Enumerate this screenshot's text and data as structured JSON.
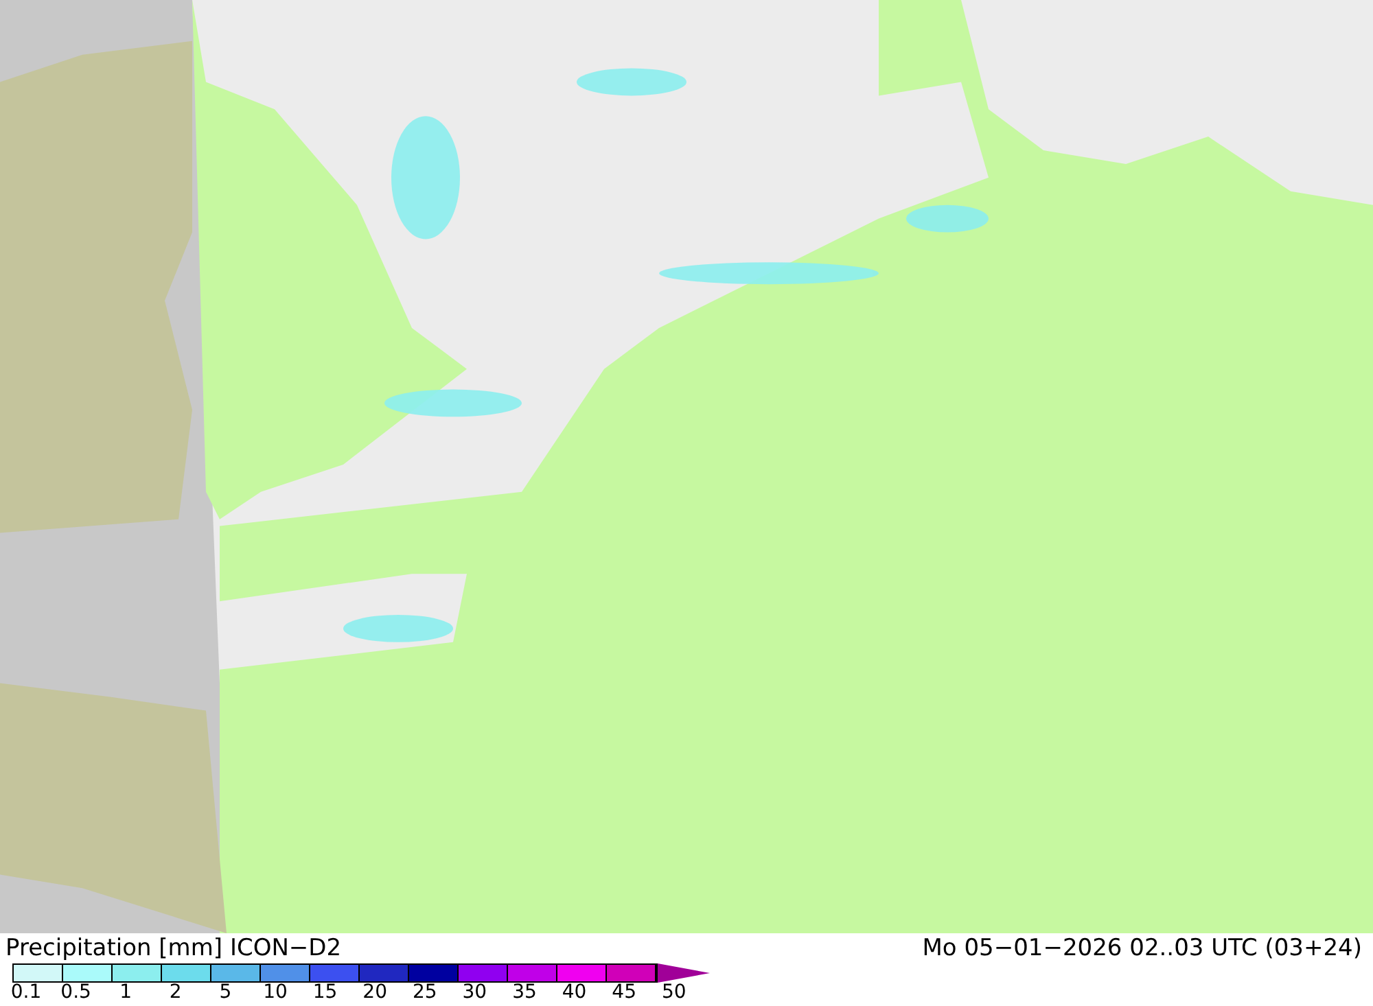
{
  "map": {
    "title": "Precipitation [mm] ICON−D2",
    "valid_time": "Mo 05−01−2026 02..03 UTC (03+24)"
  },
  "legend": {
    "bins": [
      {
        "color": "#d2f8f8"
      },
      {
        "color": "#aafafa"
      },
      {
        "color": "#8ceeee"
      },
      {
        "color": "#6cdcec"
      },
      {
        "color": "#5ab8e8"
      },
      {
        "color": "#5090e8"
      },
      {
        "color": "#3c50f0"
      },
      {
        "color": "#2028c0"
      },
      {
        "color": "#0000a0"
      },
      {
        "color": "#9000f0"
      },
      {
        "color": "#c000e8"
      },
      {
        "color": "#f000f0"
      },
      {
        "color": "#d000b8"
      }
    ],
    "ticks": [
      "0.1",
      "0.5",
      "1",
      "2",
      "5",
      "10",
      "15",
      "20",
      "25",
      "30",
      "35",
      "40",
      "45",
      "50"
    ]
  }
}
